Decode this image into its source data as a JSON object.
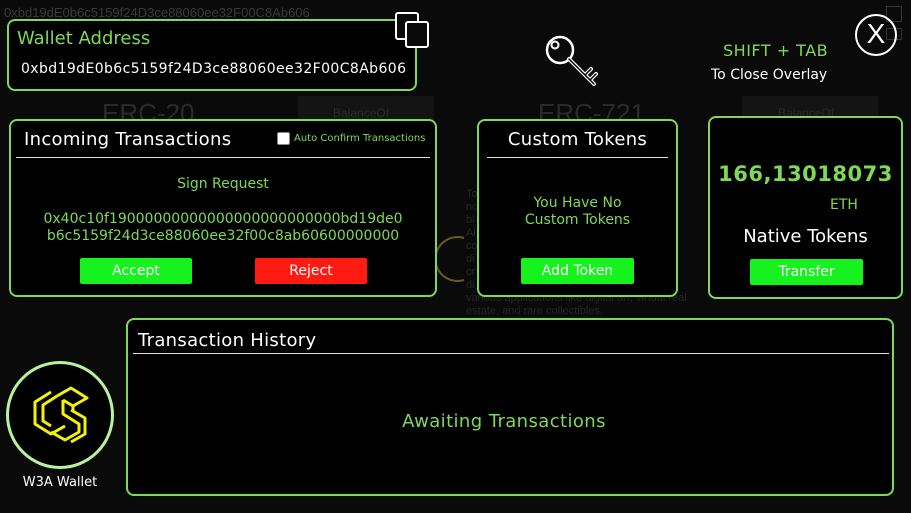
{
  "background": {
    "top_address": "0xbd19dE0b6c5159f24D3ce88060ee32F00C8Ab606",
    "erc20": "ERC-20",
    "erc721": "ERC-721",
    "balance_left": "BalanceOf",
    "balance_right": "BalanceOf",
    "body_lines": [
      "To",
      "no",
      "bl",
      "Al",
      "co",
      "di",
      "cr",
      "di",
      "various applications like digital art, virtual real",
      "estate, and rare collectibles."
    ]
  },
  "wallet": {
    "title": "Wallet Address",
    "address": "0xbd19dE0b6c5159f24D3ce88060ee32F00C8Ab606",
    "copy_icon": "copy-icon"
  },
  "key_icon": "key-icon",
  "overlay_hint": {
    "shortcut": "SHIFT + TAB",
    "description": "To Close Overlay"
  },
  "close_label": "X",
  "incoming": {
    "title": "Incoming Transactions",
    "auto_confirm_label": "Auto Confirm Transactions",
    "sign_request_label": "Sign Request",
    "data_line1": "0x40c10f19000000000000000000000000bd19de0",
    "data_line2": "b6c5159f24d3ce88060ee32f00c8ab60600000000",
    "accept_label": "Accept",
    "reject_label": "Reject"
  },
  "custom_tokens": {
    "title": "Custom Tokens",
    "empty_line1": "You Have No",
    "empty_line2": "Custom Tokens",
    "add_label": "Add Token"
  },
  "native": {
    "balance": "166,13018073",
    "unit": "ETH",
    "title": "Native Tokens",
    "transfer_label": "Transfer"
  },
  "history": {
    "title": "Transaction History",
    "empty_label": "Awaiting Transactions"
  },
  "logo": {
    "label": "W3A Wallet"
  },
  "colors": {
    "accent": "#7ed957",
    "button_green": "#15f21d",
    "button_red": "#ff1a12",
    "logo_yellow": "#f2f20a"
  }
}
